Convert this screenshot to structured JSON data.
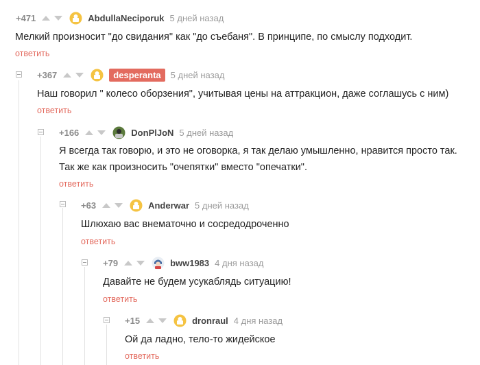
{
  "ui": {
    "reply_label": "ответить"
  },
  "comments": [
    {
      "rating": "+471",
      "username": "AbdullaNeciporuk",
      "time": "5 дней назад",
      "text": "Мелкий произносит \"до свидания\" как \"до съебаня\". В принципе, по смыслу подходит.",
      "avatar": "default-avatar-icon"
    },
    {
      "rating": "+367",
      "username": "desperanta",
      "time": "5 дней назад",
      "text": "Наш говорил \" колесо оборзения\", учитывая цены на аттракцион, даже соглашусь с ним)",
      "avatar": "default-avatar-icon",
      "highlighted": true
    },
    {
      "rating": "+166",
      "username": "DonPlJoN",
      "time": "5 дней назад",
      "text_lines": [
        "Я всегда так говорю, и это не оговорка, я так делаю умышленно, нравится просто так.",
        "Так же как произносить \"очепятки\" вместо \"опечатки\"."
      ],
      "avatar": "user-photo-avatar-icon"
    },
    {
      "rating": "+63",
      "username": "Anderwar",
      "time": "5 дней назад",
      "text": "Шлюхаю вас внематочно и сосредодроченно",
      "avatar": "default-avatar-icon"
    },
    {
      "rating": "+79",
      "username": "bww1983",
      "time": "4 дня назад",
      "text": "Давайте не будем усукаблядь ситуацию!",
      "avatar": "anime-avatar-icon"
    },
    {
      "rating": "+15",
      "username": "dronraul",
      "time": "4 дня назад",
      "text": "Ой да ладно, тело-то жидейское",
      "avatar": "default-avatar-icon"
    }
  ],
  "colors": {
    "accent": "#e36b5f",
    "rating": "#8b8b8b",
    "time": "#9a9a9a",
    "arrow": "#c8c8c8",
    "thread_line": "#e2e2e2",
    "avatar_default": "#f5c342"
  }
}
